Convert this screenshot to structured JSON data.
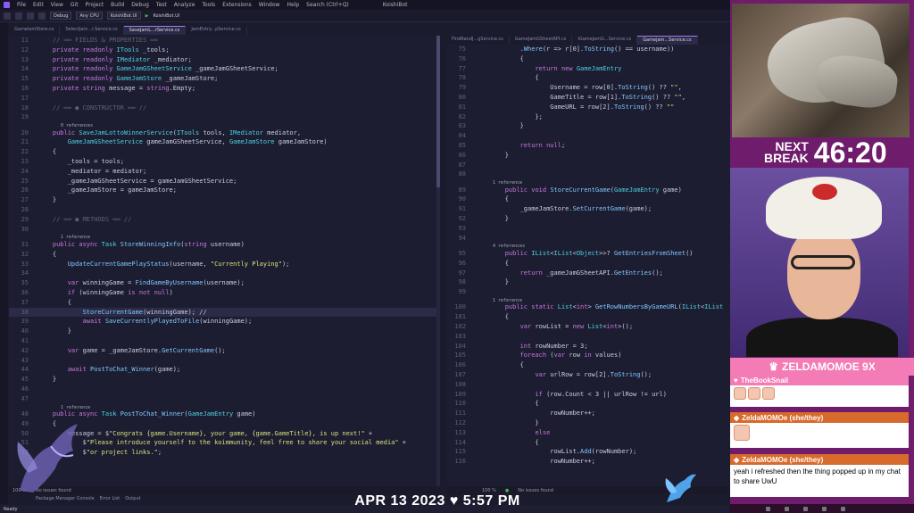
{
  "window": {
    "title": "KoishiBot",
    "menu": [
      "File",
      "Edit",
      "View",
      "Git",
      "Project",
      "Build",
      "Debug",
      "Test",
      "Analyze",
      "Tools",
      "Extensions",
      "Window",
      "Help",
      "Search (Ctrl+Q)"
    ],
    "config": "Debug",
    "platform": "Any CPU",
    "project": "KoishiBot.UI",
    "run_target": "KoishiBot.UI"
  },
  "left_tabs": [
    "GamelamStore.cs",
    "SelectJam...r.Service.cs",
    "SaveJamL...rService.cs",
    "JamEntry...pService.cs"
  ],
  "right_tabs": [
    "FindRandJ...gService.cs",
    "GameJamGSheetAPI.cs",
    "IGameJamG...Service.cs",
    "Gamejam...Service.cs"
  ],
  "left_code": [
    {
      "n": "11",
      "t": "    // ══ FIELDS & PROPERTIES ══"
    },
    {
      "n": "12",
      "t": "    private readonly ITools _tools;"
    },
    {
      "n": "13",
      "t": "    private readonly IMediator _mediator;"
    },
    {
      "n": "14",
      "t": "    private readonly GameJamGSheetService _gameJamGSheetService;"
    },
    {
      "n": "15",
      "t": "    private readonly GameJamStore _gameJamStore;"
    },
    {
      "n": "16",
      "t": "    private string message = string.Empty;"
    },
    {
      "n": "17",
      "t": ""
    },
    {
      "n": "18",
      "t": "    // ══ ● CONSTRUCTOR ══ //"
    },
    {
      "n": "19",
      "t": ""
    },
    {
      "r": "0 references"
    },
    {
      "n": "20",
      "t": "    public SaveJamLottoWinnerService(ITools tools, IMediator mediator,"
    },
    {
      "n": "21",
      "t": "        GameJamGSheetService gameJamGSheetService, GameJamStore gameJamStore)"
    },
    {
      "n": "22",
      "t": "    {"
    },
    {
      "n": "23",
      "t": "        _tools = tools;"
    },
    {
      "n": "24",
      "t": "        _mediator = mediator;"
    },
    {
      "n": "25",
      "t": "        _gameJamGSheetService = gameJamGSheetService;"
    },
    {
      "n": "26",
      "t": "        _gameJamStore = gameJamStore;"
    },
    {
      "n": "27",
      "t": "    }"
    },
    {
      "n": "28",
      "t": ""
    },
    {
      "n": "29",
      "t": "    // ══ ● METHODS ══ //"
    },
    {
      "n": "30",
      "t": ""
    },
    {
      "r": "1 reference"
    },
    {
      "n": "31",
      "t": "    public async Task StoreWinningInfo(string username)"
    },
    {
      "n": "32",
      "t": "    {"
    },
    {
      "n": "33",
      "t": "        UpdateCurrentGamePlayStatus(username, \"Currently Playing\");"
    },
    {
      "n": "34",
      "t": ""
    },
    {
      "n": "35",
      "t": "        var winningGame = FindGameByUsername(username);"
    },
    {
      "n": "36",
      "t": "        if (winningGame is not null)"
    },
    {
      "n": "37",
      "t": "        {"
    },
    {
      "n": "38",
      "t": "            StoreCurrentGame(winningGame); //"
    },
    {
      "n": "39",
      "t": "            await SaveCurrentlyPlayedToFile(winningGame);"
    },
    {
      "n": "40",
      "t": "        }"
    },
    {
      "n": "41",
      "t": ""
    },
    {
      "n": "42",
      "t": "        var game = _gameJamStore.GetCurrentGame();"
    },
    {
      "n": "43",
      "t": ""
    },
    {
      "n": "44",
      "t": "        await PostToChat_Winner(game);"
    },
    {
      "n": "45",
      "t": "    }"
    },
    {
      "n": "46",
      "t": ""
    },
    {
      "n": "47",
      "t": ""
    },
    {
      "r": "1 reference"
    },
    {
      "n": "48",
      "t": "    public async Task PostToChat_Winner(GameJamEntry game)"
    },
    {
      "n": "49",
      "t": "    {"
    },
    {
      "n": "50",
      "t": "        message = $\"Congrats {game.Username}, your game, {game.GameTitle}, is up next!\" +"
    },
    {
      "n": "51",
      "t": "            $\"Please introduce yourself to the koimmunity, feel free to share your social media\" +"
    },
    {
      "n": "52",
      "t": "            $\"or project links.\";"
    }
  ],
  "right_code": [
    {
      "n": "75",
      "t": "            .Where(r => r[0].ToString() == username))"
    },
    {
      "n": "76",
      "t": "            {"
    },
    {
      "n": "77",
      "t": "                return new GameJamEntry"
    },
    {
      "n": "78",
      "t": "                {"
    },
    {
      "n": "79",
      "t": "                    Username = row[0].ToString() ?? \"\","
    },
    {
      "n": "80",
      "t": "                    GameTitle = row[1].ToString() ?? \"\","
    },
    {
      "n": "81",
      "t": "                    GameURL = row[2].ToString() ?? \"\""
    },
    {
      "n": "82",
      "t": "                };"
    },
    {
      "n": "83",
      "t": "            }"
    },
    {
      "n": "84",
      "t": ""
    },
    {
      "n": "85",
      "t": "            return null;"
    },
    {
      "n": "86",
      "t": "        }"
    },
    {
      "n": "87",
      "t": ""
    },
    {
      "n": "88",
      "t": ""
    },
    {
      "r": "1 reference"
    },
    {
      "n": "89",
      "t": "        public void StoreCurrentGame(GameJamEntry game)"
    },
    {
      "n": "90",
      "t": "        {"
    },
    {
      "n": "91",
      "t": "            _gameJamStore.SetCurrentGame(game);"
    },
    {
      "n": "92",
      "t": "        }"
    },
    {
      "n": "93",
      "t": ""
    },
    {
      "n": "94",
      "t": ""
    },
    {
      "r": "4 references"
    },
    {
      "n": "95",
      "t": "        public IList<IList<Object>>? GetEntriesFromSheet()"
    },
    {
      "n": "96",
      "t": "        {"
    },
    {
      "n": "97",
      "t": "            return _gameJamGSheetAPI.GetEntries();"
    },
    {
      "n": "98",
      "t": "        }"
    },
    {
      "n": "99",
      "t": ""
    },
    {
      "r": "1 reference"
    },
    {
      "n": "100",
      "t": "        public static List<int> GetRowNumbersByGameURL(IList<IList"
    },
    {
      "n": "101",
      "t": "        {"
    },
    {
      "n": "102",
      "t": "            var rowList = new List<int>();"
    },
    {
      "n": "103",
      "t": ""
    },
    {
      "n": "104",
      "t": "            int rowNumber = 3;"
    },
    {
      "n": "105",
      "t": "            foreach (var row in values)"
    },
    {
      "n": "106",
      "t": "            {"
    },
    {
      "n": "107",
      "t": "                var urlRow = row[2].ToString();"
    },
    {
      "n": "108",
      "t": ""
    },
    {
      "n": "109",
      "t": "                if (row.Count < 3 || urlRow != url)"
    },
    {
      "n": "110",
      "t": "                {"
    },
    {
      "n": "111",
      "t": "                    rowNumber++;"
    },
    {
      "n": "112",
      "t": "                }"
    },
    {
      "n": "113",
      "t": "                else"
    },
    {
      "n": "114",
      "t": "                {"
    },
    {
      "n": "115",
      "t": "                    rowList.Add(rowNumber);"
    },
    {
      "n": "116",
      "t": "                    rowNumber++;"
    }
  ],
  "left_status": {
    "zoom": "100 %",
    "issues": "No issues found"
  },
  "right_status": {
    "zoom": "100 %",
    "issues": "No issues found"
  },
  "bottom_tabs": [
    "Package Manager Console",
    "Error List",
    "Output"
  ],
  "statusbar": "Ready",
  "stream": {
    "date_time": "APR 13 2023 ♥ 5:57 PM",
    "next_break_label_1": "NEXT",
    "next_break_label_2": "BREAK",
    "next_break_time": "46:20",
    "donor": "ZELDAMOMOE 9X",
    "chat": [
      {
        "user": "TheBookSnail",
        "message": "",
        "color": "#f37bb6"
      },
      {
        "user": "ZeldaMOMOe (she/they)",
        "message": "",
        "color": "#d86a2c"
      },
      {
        "user": "ZeldaMOMOe (she/they)",
        "message": "yeah i refreshed then the thing popped up in my chat to share UwU",
        "color": "#d86a2c"
      }
    ]
  }
}
